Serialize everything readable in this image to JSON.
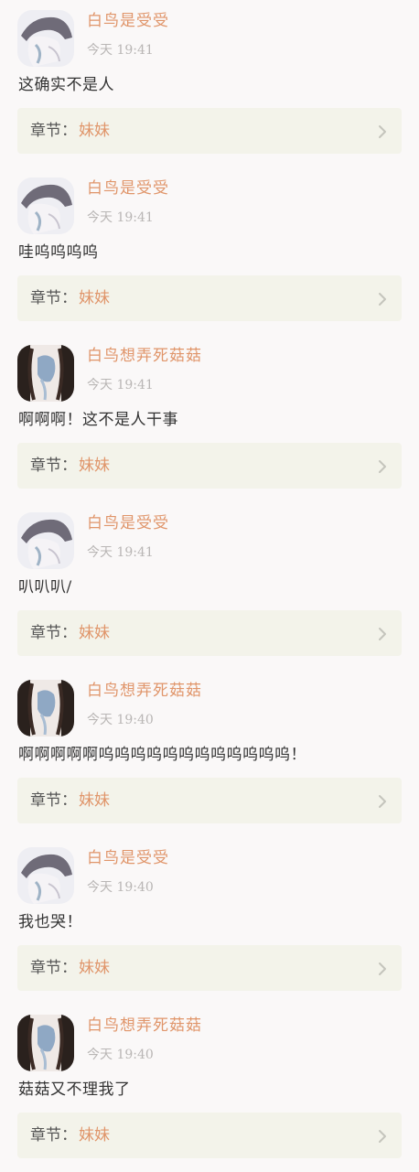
{
  "theme": {
    "accent": "#e0956a",
    "card_bg": "#f3f3ea",
    "page_bg": "#faf8f8"
  },
  "comments": [
    {
      "avatar": "grey-hat-avatar",
      "user": "白鸟是受受",
      "time": "今天 19:41",
      "text": "这确实不是人",
      "chapter_prefix": "章节：",
      "chapter": "妹妹"
    },
    {
      "avatar": "grey-hat-avatar",
      "user": "白鸟是受受",
      "time": "今天 19:41",
      "text": "哇呜呜呜呜",
      "chapter_prefix": "章节：",
      "chapter": "妹妹"
    },
    {
      "avatar": "dark-frame-avatar",
      "user": "白鸟想弄死菇菇",
      "time": "今天 19:41",
      "text": "啊啊啊！这不是人干事",
      "chapter_prefix": "章节：",
      "chapter": "妹妹"
    },
    {
      "avatar": "grey-hat-avatar",
      "user": "白鸟是受受",
      "time": "今天 19:41",
      "text": "叭叭叭/",
      "chapter_prefix": "章节：",
      "chapter": "妹妹"
    },
    {
      "avatar": "dark-frame-avatar",
      "user": "白鸟想弄死菇菇",
      "time": "今天 19:40",
      "text": "啊啊啊啊啊呜呜呜呜呜呜呜呜呜呜呜呜！",
      "chapter_prefix": "章节：",
      "chapter": "妹妹"
    },
    {
      "avatar": "grey-hat-avatar",
      "user": "白鸟是受受",
      "time": "今天 19:40",
      "text": "我也哭！",
      "chapter_prefix": "章节：",
      "chapter": "妹妹"
    },
    {
      "avatar": "dark-frame-avatar",
      "user": "白鸟想弄死菇菇",
      "time": "今天 19:40",
      "text": "菇菇又不理我了",
      "chapter_prefix": "章节：",
      "chapter": "妹妹"
    }
  ]
}
